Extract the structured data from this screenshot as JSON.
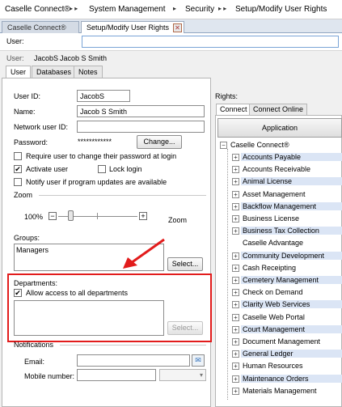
{
  "breadcrumb": [
    "Caselle Connect®",
    "System Management",
    "Security",
    "Setup/Modify User Rights"
  ],
  "doc_tabs": [
    {
      "label": "Caselle Connect®"
    },
    {
      "label": "Setup/Modify User Rights"
    }
  ],
  "user_search": {
    "label": "User:",
    "value": ""
  },
  "user_info": {
    "label": "User:",
    "id": "JacobS",
    "name": "Jacob S Smith"
  },
  "sub_tabs": [
    "User",
    "Databases",
    "Notes"
  ],
  "form": {
    "user_id_label": "User ID:",
    "user_id_value": "JacobS",
    "name_label": "Name:",
    "name_value": "Jacob S Smith",
    "network_label": "Network user ID:",
    "network_value": "",
    "password_label": "Password:",
    "password_value": "************",
    "change_btn": "Change...",
    "require_pw_label": "Require user to change their password at login",
    "require_pw_checked": false,
    "activate_label": "Activate user",
    "activate_checked": true,
    "lock_label": "Lock login",
    "lock_checked": false,
    "notify_label": "Notify user if program updates are available",
    "notify_checked": false
  },
  "zoom": {
    "section_label": "Zoom",
    "percent": "100%",
    "text": "Zoom",
    "minus": "−",
    "plus": "+"
  },
  "groups": {
    "label": "Groups:",
    "items": [
      "Managers"
    ],
    "select_btn": "Select..."
  },
  "departments": {
    "label": "Departments:",
    "allow_all_label": "Allow access to all departments",
    "allow_all_checked": true,
    "select_btn": "Select..."
  },
  "notifications": {
    "label": "Notifications",
    "email_label": "Email:",
    "email_value": "",
    "mobile_label": "Mobile number:",
    "mobile_value": ""
  },
  "rights": {
    "label": "Rights:",
    "tabs": [
      "Connect",
      "Connect Online"
    ],
    "app_button": "Application",
    "root": "Caselle Connect®",
    "items": [
      {
        "label": "Accounts Payable",
        "expandable": true,
        "highlight": true
      },
      {
        "label": "Accounts Receivable",
        "expandable": true,
        "highlight": false
      },
      {
        "label": "Animal License",
        "expandable": true,
        "highlight": true
      },
      {
        "label": "Asset Management",
        "expandable": true,
        "highlight": false
      },
      {
        "label": "Backflow Management",
        "expandable": true,
        "highlight": true
      },
      {
        "label": "Business License",
        "expandable": true,
        "highlight": false
      },
      {
        "label": "Business Tax Collection",
        "expandable": true,
        "highlight": true
      },
      {
        "label": "Caselle Advantage",
        "expandable": false,
        "highlight": false
      },
      {
        "label": "Community Development",
        "expandable": true,
        "highlight": true
      },
      {
        "label": "Cash Receipting",
        "expandable": true,
        "highlight": false
      },
      {
        "label": "Cemetery Management",
        "expandable": true,
        "highlight": true
      },
      {
        "label": "Check on Demand",
        "expandable": true,
        "highlight": false
      },
      {
        "label": "Clarity Web Services",
        "expandable": true,
        "highlight": true
      },
      {
        "label": "Caselle Web Portal",
        "expandable": true,
        "highlight": false
      },
      {
        "label": "Court Management",
        "expandable": true,
        "highlight": true
      },
      {
        "label": "Document Management",
        "expandable": true,
        "highlight": false
      },
      {
        "label": "General Ledger",
        "expandable": true,
        "highlight": true
      },
      {
        "label": "Human Resources",
        "expandable": true,
        "highlight": false
      },
      {
        "label": "Maintenance Orders",
        "expandable": true,
        "highlight": true
      },
      {
        "label": "Materials Management",
        "expandable": true,
        "highlight": false
      }
    ]
  },
  "colors": {
    "annotation": "#e21c1c",
    "highlight": "#dbe5f5",
    "focus_border": "#7aa4d6"
  }
}
